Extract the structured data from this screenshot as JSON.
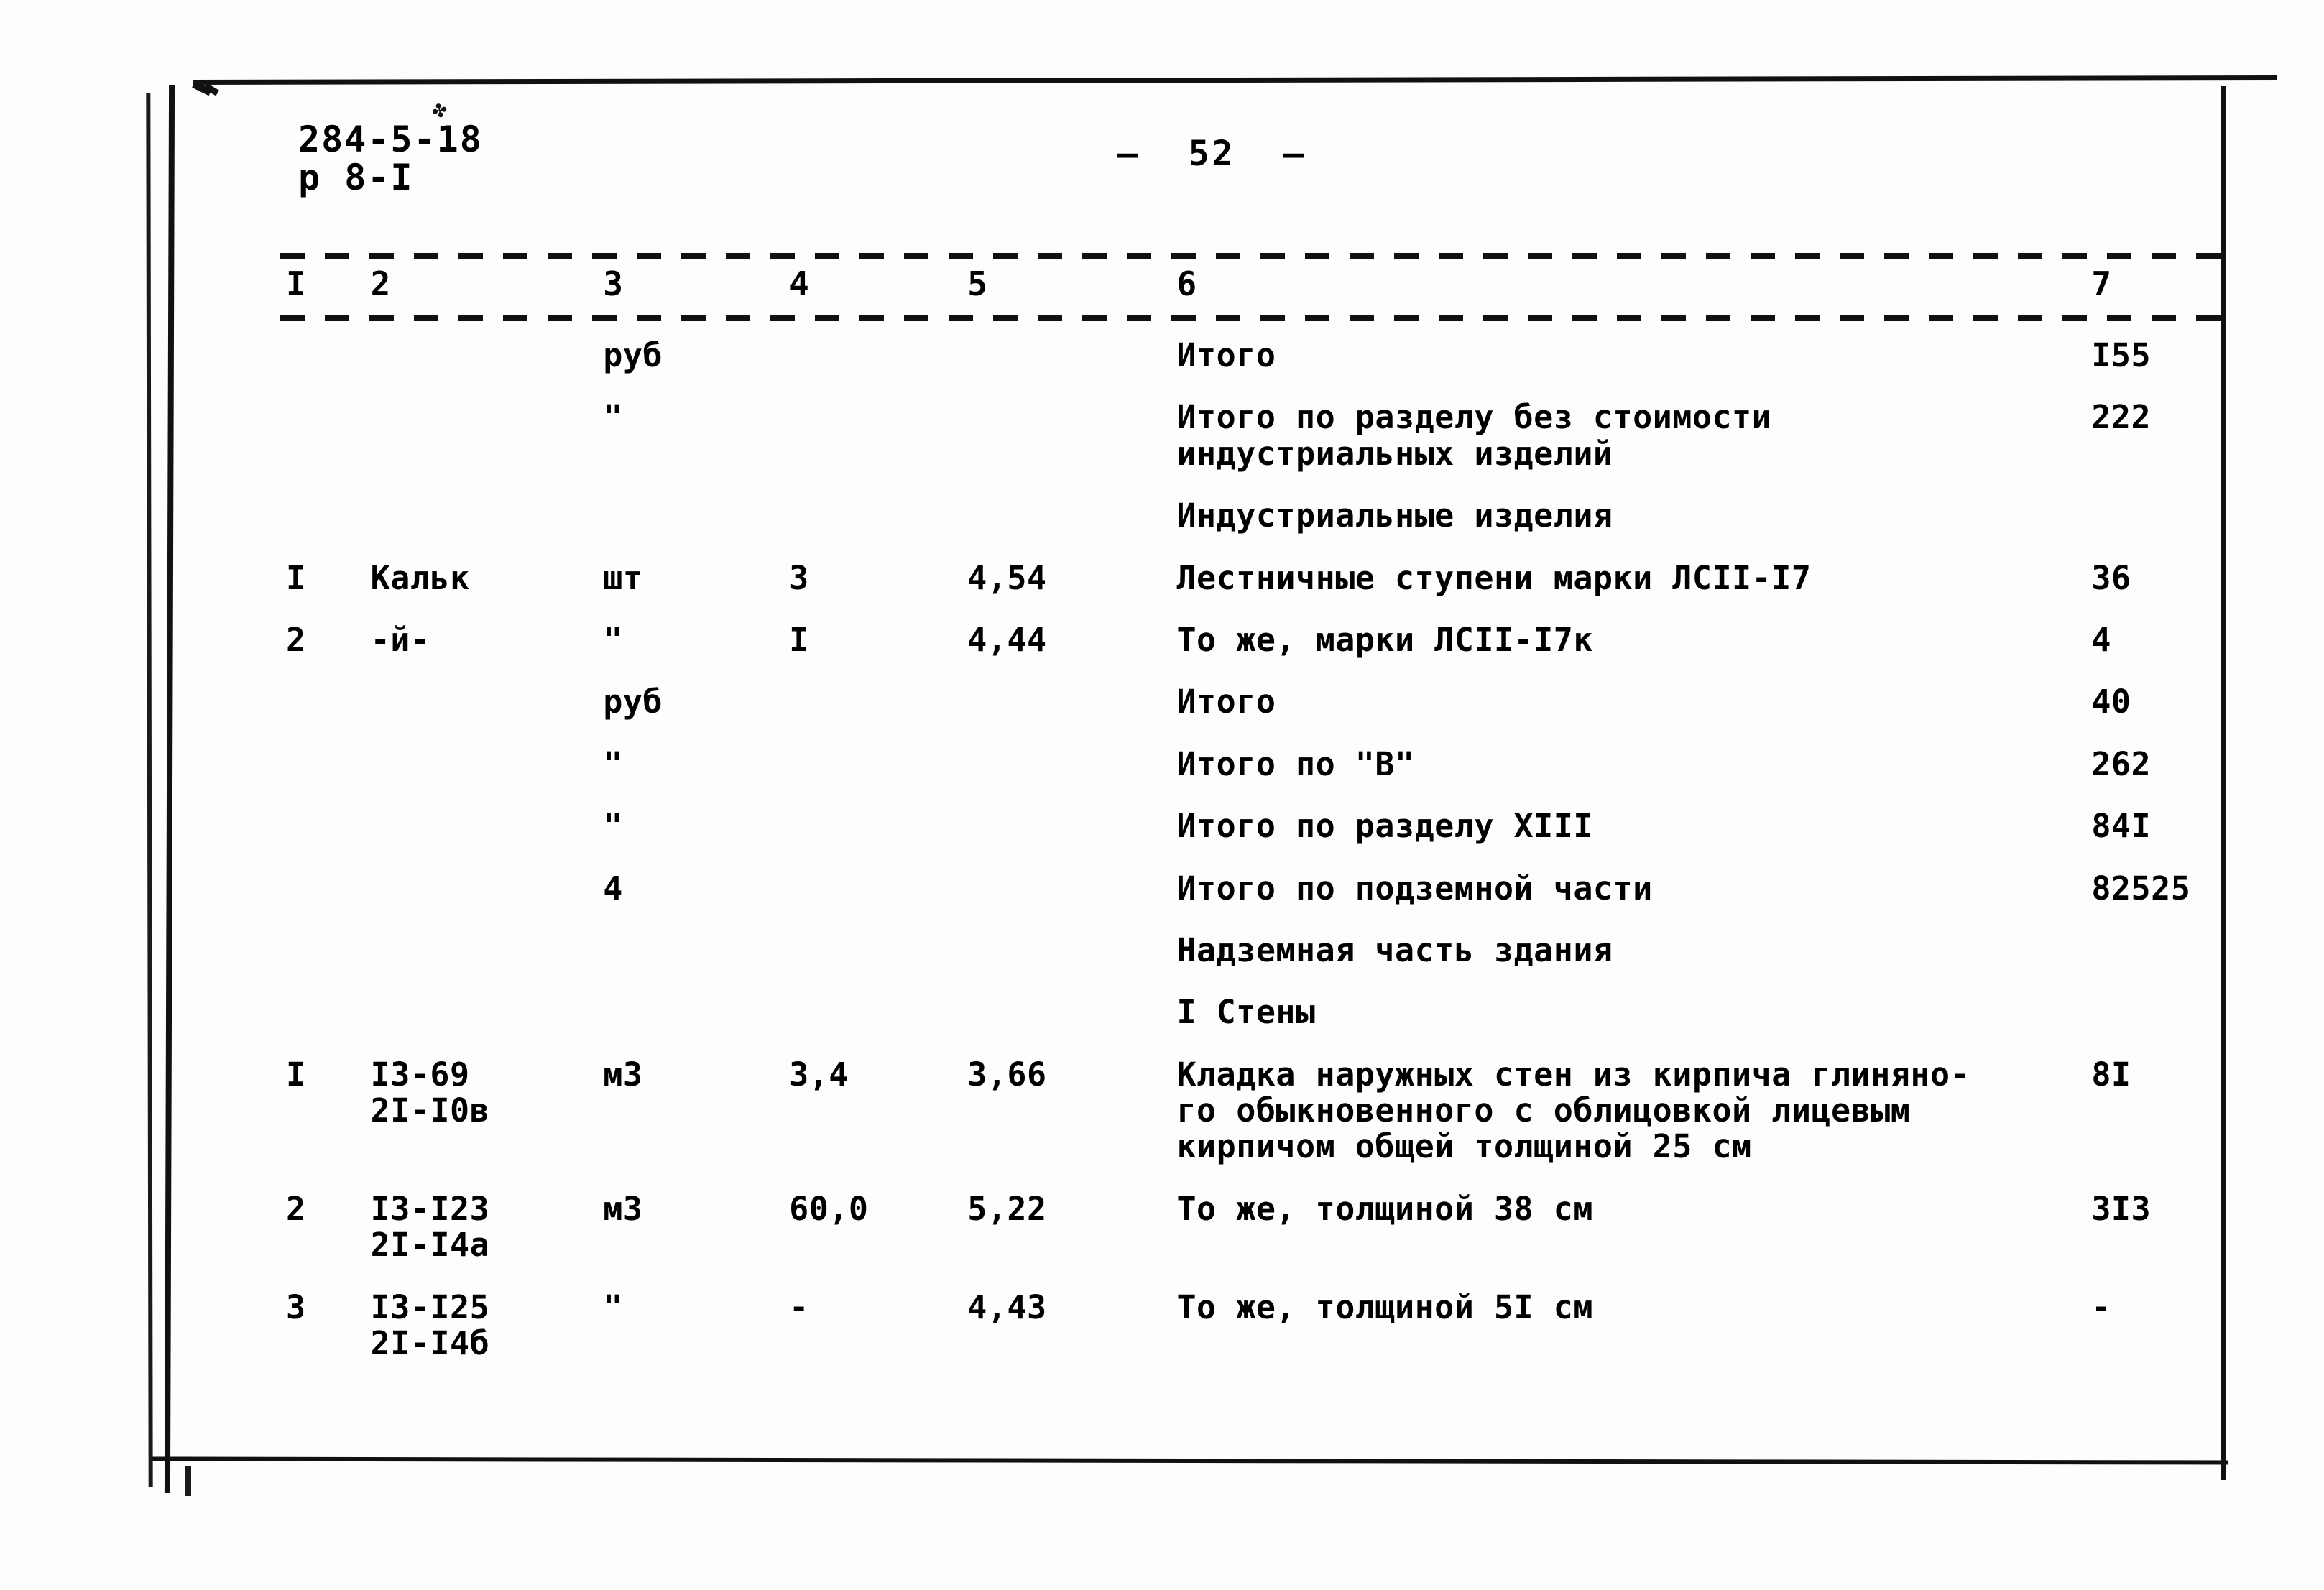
{
  "document": {
    "code_line1": "284-5-18",
    "code_line2": "р 8-I",
    "ink_smudge": "✤",
    "page_number": "—  52  —"
  },
  "table": {
    "headers": [
      "I",
      "2",
      "3",
      "4",
      "5",
      "6",
      "7"
    ],
    "rows": [
      {
        "no": "",
        "ref": "",
        "unit": "руб",
        "qty": "",
        "price": "",
        "description": "Итого",
        "total": "I55"
      },
      {
        "no": "",
        "ref": "",
        "unit": "\"",
        "qty": "",
        "price": "",
        "description": "Итого по разделу без стоимости\nиндустриальных изделий",
        "total": "222"
      },
      {
        "no": "",
        "ref": "",
        "unit": "",
        "qty": "",
        "price": "",
        "description": "Индустриальные изделия",
        "total": ""
      },
      {
        "no": "I",
        "ref": "Кальк",
        "unit": "шт",
        "qty": "3",
        "price": "4,54",
        "description": "Лестничные ступени марки ЛСII-I7",
        "total": "36"
      },
      {
        "no": "2",
        "ref": "-й-",
        "unit": "\"",
        "qty": "I",
        "price": "4,44",
        "description": "То же, марки ЛСII-I7к",
        "total": "4"
      },
      {
        "no": "",
        "ref": "",
        "unit": "руб",
        "qty": "",
        "price": "",
        "description": "Итого",
        "total": "40"
      },
      {
        "no": "",
        "ref": "",
        "unit": "\"",
        "qty": "",
        "price": "",
        "description": "Итого по \"В\"",
        "total": "262"
      },
      {
        "no": "",
        "ref": "",
        "unit": "\"",
        "qty": "",
        "price": "",
        "description": "Итого по разделу ХIII",
        "total": "84I"
      },
      {
        "no": "",
        "ref": "",
        "unit": "4",
        "qty": "",
        "price": "",
        "description": "Итого по подземной части",
        "total": "82525"
      },
      {
        "no": "",
        "ref": "",
        "unit": "",
        "qty": "",
        "price": "",
        "description": "Надземная часть здания",
        "total": ""
      },
      {
        "no": "",
        "ref": "",
        "unit": "",
        "qty": "",
        "price": "",
        "description": "  I   Стены",
        "total": ""
      },
      {
        "no": "I",
        "ref": "I3-69\n2I-I0в",
        "unit": "м3",
        "qty": "3,4",
        "price": "3,66",
        "description": "Кладка наружных стен из кирпича глиняно-\nго обыкновенного с облицовкой лицевым\nкирпичом общей толщиной 25 см",
        "total": "8I"
      },
      {
        "no": "2",
        "ref": "I3-I23\n2I-I4а",
        "unit": "м3",
        "qty": "60,0",
        "price": "5,22",
        "description": "То же, толщиной 38 см",
        "total": "3I3"
      },
      {
        "no": "3",
        "ref": "I3-I25\n2I-I4б",
        "unit": "\"",
        "qty": "-",
        "price": "4,43",
        "description": "То же, толщиной 5I см",
        "total": "-"
      }
    ]
  }
}
